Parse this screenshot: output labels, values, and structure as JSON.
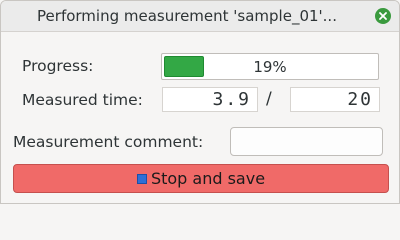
{
  "window": {
    "title": "Performing measurement 'sample_01'...",
    "close_icon": "close-icon"
  },
  "progress": {
    "label": "Progress:",
    "value_text": "19%",
    "fraction": 0.19,
    "fill_color": "#33a845"
  },
  "time": {
    "label": "Measured time:",
    "elapsed": "3.9",
    "separator": "/",
    "total": "20"
  },
  "comment": {
    "label": "Measurement comment:",
    "value": ""
  },
  "stop_button": {
    "label": "Stop and save",
    "icon": "stop-icon",
    "color": "#f06a68"
  }
}
